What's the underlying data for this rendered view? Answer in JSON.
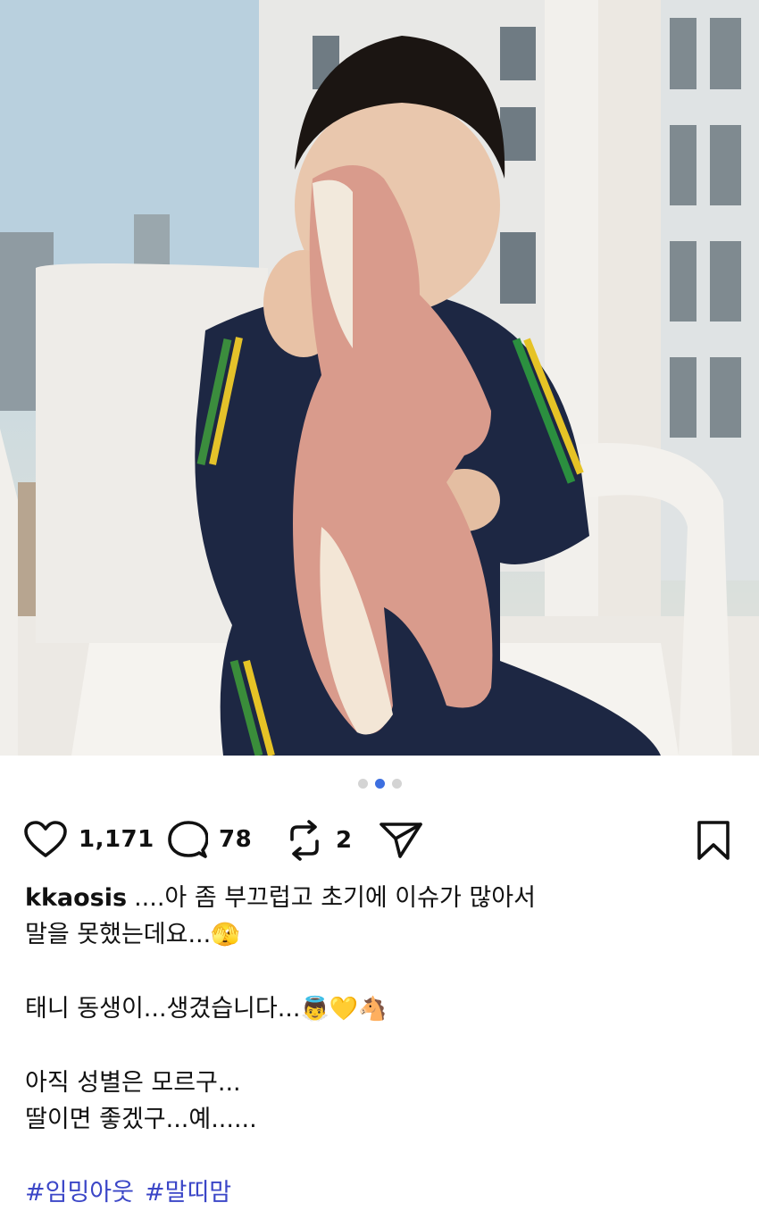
{
  "post": {
    "carousel": {
      "page_count": 3,
      "active_index": 1
    },
    "actions": {
      "likes": "1,171",
      "comments": "78",
      "reposts": "2"
    },
    "caption": {
      "username": "kkaosis",
      "line1": "....아 좀 부끄럽고 초기에 이슈가 많아서",
      "line2": "말을 못했는데요...",
      "line2_emoji": "🫣",
      "line3": "태니 동생이...생겼습니다...",
      "line3_emojis": "👼💛🐴",
      "line4": "아직 성별은 모르구...",
      "line5": "딸이면 좋겠구...예......"
    },
    "hashtags": [
      "#임밍아웃",
      "#말띠맘"
    ],
    "colors": {
      "accent_blue": "#3d6fe0",
      "hashtag": "#3b46c7",
      "icon": "#111111"
    },
    "icons": [
      "heart-icon",
      "comment-icon",
      "repost-icon",
      "share-icon",
      "bookmark-icon"
    ]
  }
}
